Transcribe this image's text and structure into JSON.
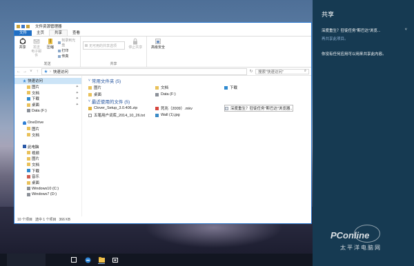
{
  "window": {
    "title": "文件资源管理器",
    "tabs": [
      "文件",
      "主页",
      "共享",
      "查看"
    ],
    "ribbon": {
      "send_group": {
        "label": "发送",
        "share": "共享",
        "email": "发送\n电子邮件",
        "zip": "压缩",
        "small": [
          "刻录到光盘",
          "打印",
          "传真"
        ]
      },
      "share_group": {
        "label": "共享",
        "share_with": "无可用的共享选项",
        "stop_share": "停止共享"
      },
      "advanced_security": "高级安全"
    },
    "address": {
      "path": "快速访问",
      "search_placeholder": "搜索\"快速访问\""
    },
    "nav_pane": [
      {
        "label": "快速访问",
        "icon": "star-icon",
        "sel": true,
        "indent": 1
      },
      {
        "label": "图片",
        "icon": "folder-icon",
        "pin": true,
        "indent": 2
      },
      {
        "label": "文档",
        "icon": "folder-icon",
        "pin": true,
        "indent": 2
      },
      {
        "label": "下载",
        "icon": "download-icon",
        "pin": true,
        "indent": 2
      },
      {
        "label": "桌面",
        "icon": "folder-icon",
        "pin": true,
        "indent": 2
      },
      {
        "label": "Data (F:)",
        "icon": "drive-icon",
        "indent": 2
      },
      {
        "label": "",
        "icon": "",
        "indent": 0
      },
      {
        "label": "OneDrive",
        "icon": "cloud-icon",
        "indent": 1
      },
      {
        "label": "图片",
        "icon": "folder-icon",
        "indent": 2
      },
      {
        "label": "文档",
        "icon": "folder-icon",
        "indent": 2
      },
      {
        "label": "",
        "icon": "",
        "indent": 0
      },
      {
        "label": "此电脑",
        "icon": "pc-icon",
        "indent": 1
      },
      {
        "label": "视频",
        "icon": "folder-icon",
        "indent": 2
      },
      {
        "label": "图片",
        "icon": "folder-icon",
        "indent": 2
      },
      {
        "label": "文档",
        "icon": "folder-icon",
        "indent": 2
      },
      {
        "label": "下载",
        "icon": "download-icon",
        "indent": 2
      },
      {
        "label": "音乐",
        "icon": "music-icon",
        "indent": 2
      },
      {
        "label": "桌面",
        "icon": "folder-icon",
        "indent": 2
      },
      {
        "label": "Windows10 (C:)",
        "icon": "drive-icon",
        "indent": 2
      },
      {
        "label": "Windows7 (D:)",
        "icon": "drive-icon",
        "indent": 2
      }
    ],
    "sections": {
      "frequent": "常用文件夹 (5)",
      "recent": "最近使用的文件 (5)"
    },
    "frequent_items": [
      {
        "label": "图片",
        "icon": "folder-icon"
      },
      {
        "label": "文档",
        "icon": "folder-icon"
      },
      {
        "label": "下载",
        "icon": "download-icon"
      },
      {
        "label": "桌面",
        "icon": "folder-icon"
      },
      {
        "label": "Data (F:)",
        "icon": "drive-icon"
      }
    ],
    "recent_items": [
      {
        "label": "Clover_Setup_3.0.406.zip",
        "icon": "zip-icon"
      },
      {
        "label": "死兆（2009）.mkv",
        "icon": "video-icon"
      },
      {
        "label": "深度重生？狂徒任务\"斯巴达\"浏览器...",
        "icon": "doc-icon",
        "hl": true
      },
      {
        "label": "五笔用户词库_2014_10_26.txt",
        "icon": "text-icon"
      },
      {
        "label": "Wall (1).jpg",
        "icon": "image-icon"
      }
    ],
    "status": [
      "10 个项目",
      "选中 1 个项目",
      "366 KB"
    ]
  },
  "share_pane": {
    "heading": "共享",
    "item": "深度重生？狂徒任务\"斯巴达\"浏览...",
    "link": "再共享此项目。",
    "message": "你没有任何应用可以用来共享此内容。"
  },
  "watermark": {
    "brand": "PConline",
    "sub": "太平洋电脑网"
  }
}
